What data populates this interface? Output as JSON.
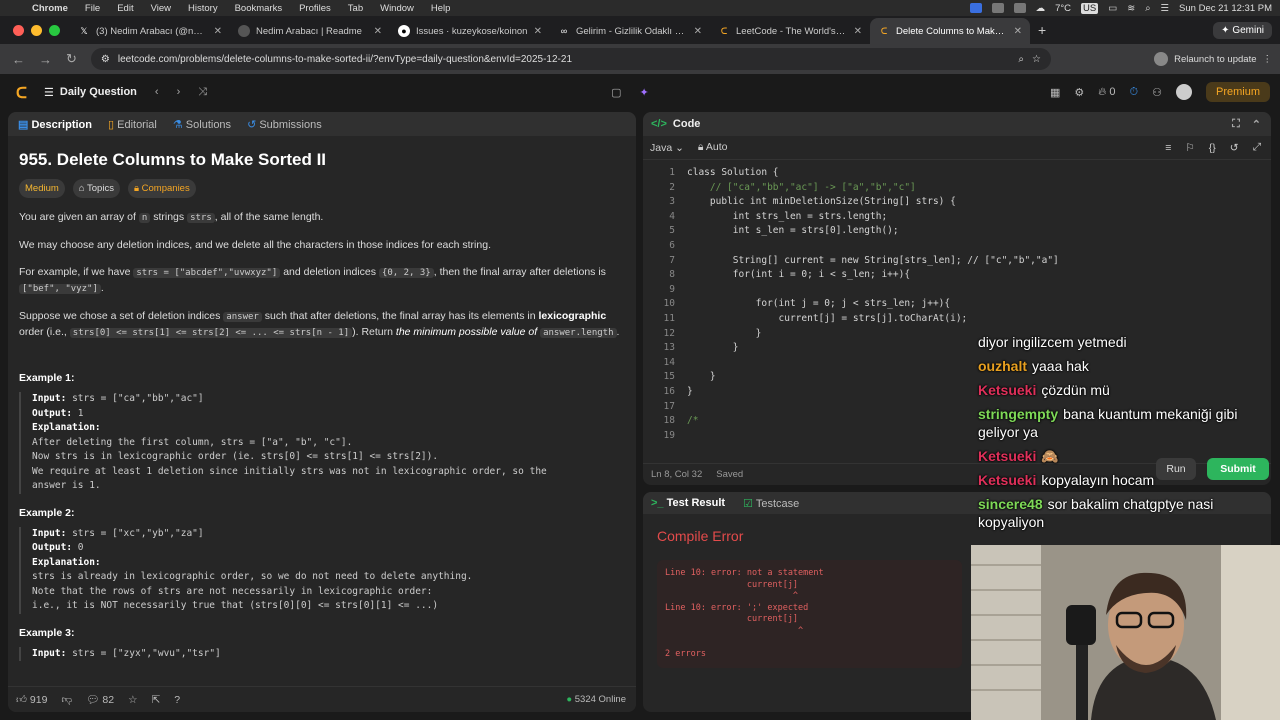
{
  "menubar": {
    "app": "Chrome",
    "items": [
      "File",
      "Edit",
      "View",
      "History",
      "Bookmarks",
      "Profiles",
      "Tab",
      "Window",
      "Help"
    ],
    "temp": "7°C",
    "input": "US",
    "datetime": "Sun Dec 21  12:31 PM"
  },
  "tabs": [
    {
      "title": "(3) Nedim Arabacı (@needim",
      "icon": "x-icon",
      "color": "#000000"
    },
    {
      "title": "Nedim Arabacı | Readme",
      "icon": "readme-icon",
      "color": "#555555"
    },
    {
      "title": "Issues · kuzeykose/koinon",
      "icon": "github-icon",
      "color": "#24292e"
    },
    {
      "title": "Gelirim - Gizlilik Odaklı Finans",
      "icon": "link-icon",
      "color": "#333333"
    },
    {
      "title": "LeetCode - The World's Lead",
      "icon": "leetcode-icon",
      "color": "#f5a623"
    },
    {
      "title": "Delete Columns to Make Sort",
      "icon": "leetcode-icon",
      "color": "#f5a623"
    }
  ],
  "gemini": "Gemini",
  "address": {
    "url": "leetcode.com/problems/delete-columns-to-make-sorted-ii/?envType=daily-question&envId=2025-12-21",
    "relaunch": "Relaunch to update"
  },
  "lcnav": {
    "daily": "Daily Question",
    "streak": "0",
    "premium": "Premium"
  },
  "left_tabs": [
    "Description",
    "Editorial",
    "Solutions",
    "Submissions"
  ],
  "problem": {
    "title": "955. Delete Columns to Make Sorted II",
    "difficulty": "Medium",
    "topics": "Topics",
    "companies": "Companies",
    "p1a": "You are given an array of",
    "p1code": "n",
    "p1b": "strings",
    "p1code2": "strs",
    "p1c": ", all of the same length.",
    "p2": "We may choose any deletion indices, and we delete all the characters in those indices for each string.",
    "p3a": "For example, if we have",
    "p3code": "strs = [\"abcdef\",\"uvwxyz\"]",
    "p3b": "and deletion indices",
    "p3code2": "{0, 2, 3}",
    "p3c": ", then the final array after deletions is",
    "p3code3": "[\"bef\", \"vyz\"]",
    "p4a": "Suppose we chose a set of deletion indices",
    "p4code": "answer",
    "p4b": "such that after deletions, the final array has its elements in",
    "p4bold": "lexicographic",
    "p4c": "order (i.e.,",
    "p4code2": "strs[0] <= strs[1] <= strs[2] <= ... <= strs[n - 1]",
    "p4d": "). Return",
    "p4em": "the minimum possible value of",
    "p4code3": "answer.length",
    "p4e": "."
  },
  "examples": [
    {
      "heading": "Example 1:",
      "input": "strs = [\"ca\",\"bb\",\"ac\"]",
      "output": "1",
      "explanation": "After deleting the first column, strs = [\"a\", \"b\", \"c\"].\nNow strs is in lexicographic order (ie. strs[0] <= strs[1] <= strs[2]).\nWe require at least 1 deletion since initially strs was not in lexicographic order, so the\nanswer is 1."
    },
    {
      "heading": "Example 2:",
      "input": "strs = [\"xc\",\"yb\",\"za\"]",
      "output": "0",
      "explanation": "strs is already in lexicographic order, so we do not need to delete anything.\nNote that the rows of strs are not necessarily in lexicographic order:\ni.e., it is NOT necessarily true that (strs[0][0] <= strs[0][1] <= ...)"
    },
    {
      "heading": "Example 3:",
      "input": "strs = [\"zyx\",\"wvu\",\"tsr\"]",
      "output": "",
      "explanation": ""
    }
  ],
  "labels": {
    "input": "Input:",
    "output": "Output:",
    "explanation": "Explanation:"
  },
  "left_footer": {
    "likes": "919",
    "comments": "82",
    "online": "5324 Online"
  },
  "code": {
    "header": "Code",
    "language": "Java",
    "auto": "Auto",
    "lines": [
      "class Solution {",
      "    // [\"ca\",\"bb\",\"ac\"] -> [\"a\",\"b\",\"c\"]",
      "    public int minDeletionSize(String[] strs) {",
      "        int strs_len = strs.length;",
      "        int s_len = strs[0].length();",
      "",
      "        String[] current = new String[strs_len]; // [\"c\",\"b\",\"a\"]",
      "        for(int i = 0; i < s_len; i++){",
      "",
      "            for(int j = 0; j < strs_len; j++){",
      "                current[j] = strs[j].toCharAt(i);",
      "            }",
      "        }",
      "",
      "    }",
      "}",
      "",
      "/*",
      ""
    ],
    "status_pos": "Ln 8, Col 32",
    "status_saved": "Saved"
  },
  "result": {
    "tab1": "Test Result",
    "tab2": "Testcase",
    "title": "Compile Error",
    "errors": "Line 10: error: not a statement\n                current[j]\n                         ^\nLine 10: error: ';' expected\n                current[j]\n                          ^\n\n2 errors"
  },
  "buttons": {
    "run": "Run",
    "submit": "Submit"
  },
  "chat": [
    {
      "user": "",
      "msg": "diyor ingilizcem yetmedi",
      "color": "#ffffff"
    },
    {
      "user": "ouzhalt",
      "msg": "yaaa hak",
      "color": "#e8a020"
    },
    {
      "user": "Ketsueki",
      "msg": "çözdün mü",
      "color": "#e0305a"
    },
    {
      "user": "stringempty",
      "msg": "bana kuantum mekaniği gibi geliyor ya",
      "color": "#7ed957"
    },
    {
      "user": "Ketsueki",
      "msg": "🙈",
      "color": "#e0305a"
    },
    {
      "user": "Ketsueki",
      "msg": "kopyalayın hocam",
      "color": "#e0305a"
    },
    {
      "user": "sincere48",
      "msg": "sor bakalim chatgptye nasi kopyaliyon",
      "color": "#7ed957"
    }
  ]
}
